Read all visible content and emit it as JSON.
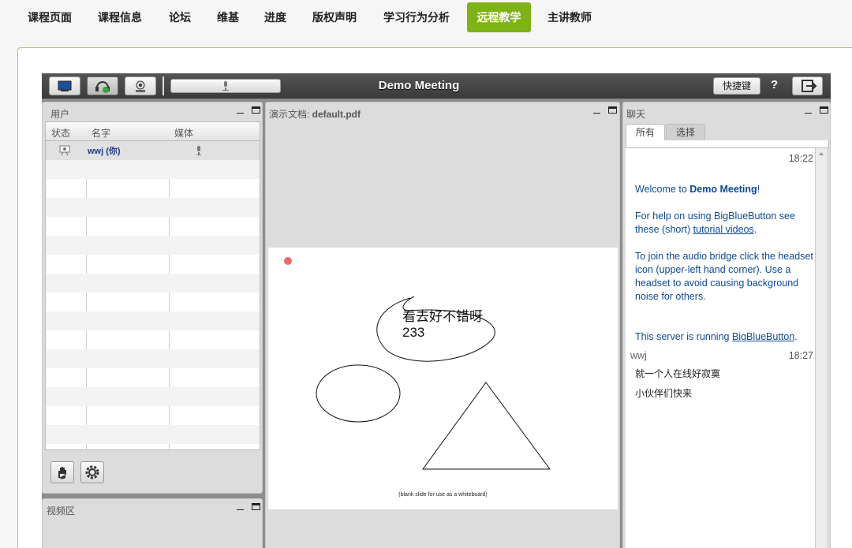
{
  "nav": {
    "tabs": [
      {
        "label": "课程页面",
        "active": false
      },
      {
        "label": "课程信息",
        "active": false
      },
      {
        "label": "论坛",
        "active": false
      },
      {
        "label": "维基",
        "active": false
      },
      {
        "label": "进度",
        "active": false
      },
      {
        "label": "版权声明",
        "active": false
      },
      {
        "label": "学习行为分析",
        "active": false
      },
      {
        "label": "远程教学",
        "active": true
      },
      {
        "label": "主讲教师",
        "active": false
      }
    ],
    "active_color": "#7fb217"
  },
  "toolbar": {
    "meeting_title": "Demo Meeting",
    "shortcut_label": "快捷键",
    "help_label": "?",
    "icons": [
      "desktop-share-icon",
      "headset-icon",
      "webcam-icon",
      "microphone-icon",
      "logout-icon"
    ]
  },
  "users_panel": {
    "title": "用户",
    "columns": [
      "状态",
      "名字",
      "媒体"
    ],
    "rows": [
      {
        "status_icon": "presenter-icon",
        "name": "wwj (你)",
        "media_icon": "microphone-icon"
      }
    ],
    "raise_hand_icon": "raise-hand-icon",
    "settings_icon": "gear-icon"
  },
  "video_panel": {
    "title": "视频区"
  },
  "presentation_panel": {
    "title_prefix": "演示文档: ",
    "filename": "default.pdf",
    "annotation_text_line1": "看去好不错呀",
    "annotation_text_line2": "233",
    "caption": "(blank slide for use as a whiteboard)",
    "laser_color": "#ee6a6a"
  },
  "chat_panel": {
    "title": "聊天",
    "tabs": [
      {
        "label": "所有",
        "active": true
      },
      {
        "label": "选择",
        "active": false
      }
    ],
    "welcome_time": "18:22",
    "welcome_prefix": "Welcome to ",
    "welcome_meeting": "Demo Meeting",
    "welcome_suffix": "!",
    "help_prefix": "For help on using BigBlueButton see these (short) ",
    "help_link": "tutorial videos",
    "help_suffix": ".",
    "audio_text": "To join the audio bridge click the headset icon (upper-left hand corner).  Use a headset to avoid causing background noise for others.",
    "server_prefix": "This server is running ",
    "server_link": "BigBlueButton",
    "server_suffix": ".",
    "user_sender": "wwj",
    "user_time": "18:27",
    "user_messages": [
      "就一个人在线好寂寞",
      "小伙伴们快来"
    ]
  }
}
